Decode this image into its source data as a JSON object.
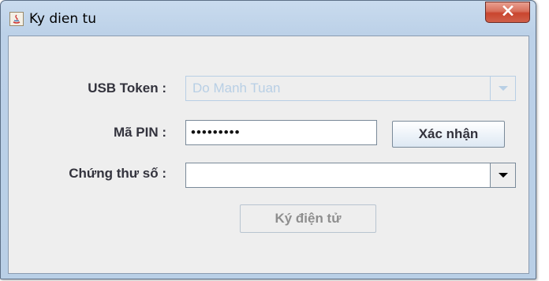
{
  "window": {
    "title": "Ky dien tu",
    "close_label": "X"
  },
  "form": {
    "usb_token_label": "USB Token :",
    "usb_token_value": "Do Manh Tuan",
    "pin_label": "Mã PIN :",
    "pin_value": "•••••••••",
    "confirm_button": "Xác nhận",
    "certificate_label": "Chứng thư số :",
    "certificate_value": "",
    "sign_button": "Ký điện tử"
  }
}
